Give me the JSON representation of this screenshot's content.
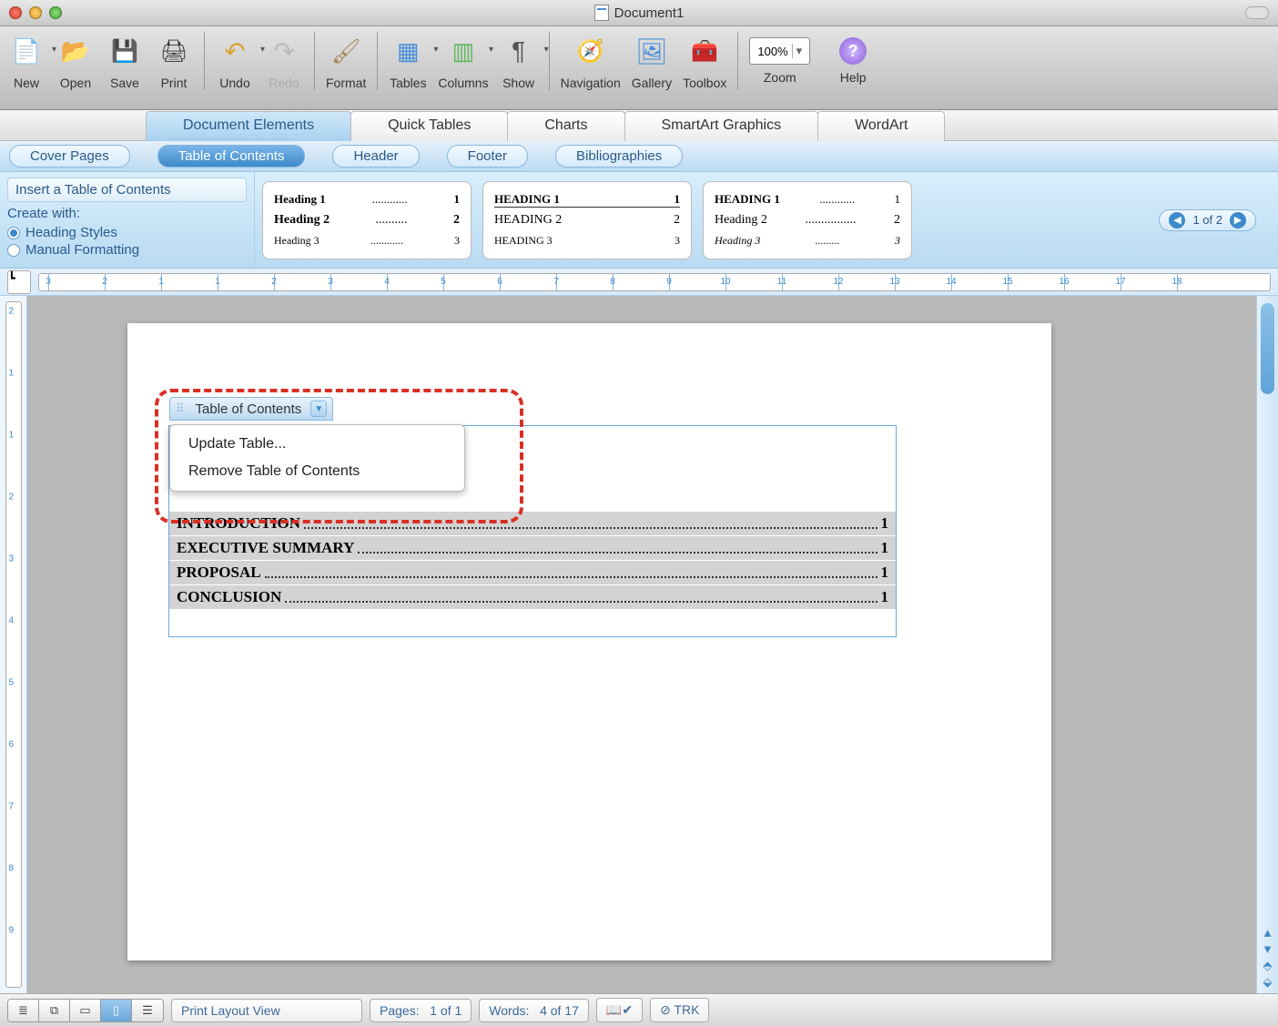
{
  "window": {
    "title": "Document1"
  },
  "toolbar": {
    "items": [
      {
        "id": "new",
        "label": "New"
      },
      {
        "id": "open",
        "label": "Open"
      },
      {
        "id": "save",
        "label": "Save"
      },
      {
        "id": "print",
        "label": "Print"
      },
      {
        "id": "undo",
        "label": "Undo"
      },
      {
        "id": "redo",
        "label": "Redo"
      },
      {
        "id": "format",
        "label": "Format"
      },
      {
        "id": "tables",
        "label": "Tables"
      },
      {
        "id": "columns",
        "label": "Columns"
      },
      {
        "id": "show",
        "label": "Show"
      },
      {
        "id": "navigation",
        "label": "Navigation"
      },
      {
        "id": "gallery",
        "label": "Gallery"
      },
      {
        "id": "toolbox",
        "label": "Toolbox"
      }
    ],
    "zoom": {
      "value": "100%",
      "label": "Zoom"
    },
    "help": {
      "label": "Help"
    }
  },
  "ribbon_tabs": [
    "Document Elements",
    "Quick Tables",
    "Charts",
    "SmartArt Graphics",
    "WordArt"
  ],
  "ribbon_active_index": 0,
  "subribbon": [
    "Cover Pages",
    "Table of Contents",
    "Header",
    "Footer",
    "Bibliographies"
  ],
  "subribbon_active_index": 1,
  "options": {
    "header": "Insert a Table of Contents",
    "create_with": "Create with:",
    "radios": [
      "Heading Styles",
      "Manual Formatting"
    ],
    "selected_radio": 0
  },
  "gallery": {
    "pager": "1 of 2",
    "items": [
      {
        "rows": [
          [
            "Heading 1",
            "1"
          ],
          [
            "Heading 2",
            "2"
          ],
          [
            "Heading 3",
            "3"
          ]
        ],
        "style": "bold"
      },
      {
        "rows": [
          [
            "HEADING 1",
            "1"
          ],
          [
            "HEADING 2",
            "2"
          ],
          [
            "HEADING 3",
            "3"
          ]
        ],
        "style": "smallcaps"
      },
      {
        "rows": [
          [
            "HEADING 1",
            "1"
          ],
          [
            "Heading 2",
            "2"
          ],
          [
            "Heading 3",
            "3"
          ]
        ],
        "style": "italic"
      }
    ]
  },
  "ruler": {
    "marks": [
      3,
      2,
      1,
      1,
      2,
      3,
      4,
      5,
      6,
      7,
      8,
      9,
      10,
      11,
      12,
      13,
      14,
      15,
      16,
      17,
      18
    ]
  },
  "vruler": {
    "marks": [
      2,
      1,
      1,
      2,
      3,
      4,
      5,
      6,
      7,
      8,
      9
    ]
  },
  "toc_field": {
    "handle_label": "Table of Contents",
    "menu": [
      "Update Table...",
      "Remove Table of Contents"
    ],
    "entries": [
      {
        "title": "INTRODUCTION",
        "page": "1"
      },
      {
        "title": "EXECUTIVE SUMMARY",
        "page": "1"
      },
      {
        "title": "PROPOSAL",
        "page": "1"
      },
      {
        "title": "CONCLUSION",
        "page": "1"
      }
    ]
  },
  "statusbar": {
    "view_label": "Print Layout View",
    "pages_label": "Pages:",
    "pages_value": "1 of 1",
    "words_label": "Words:",
    "words_value": "4 of 17",
    "trk": "TRK"
  }
}
